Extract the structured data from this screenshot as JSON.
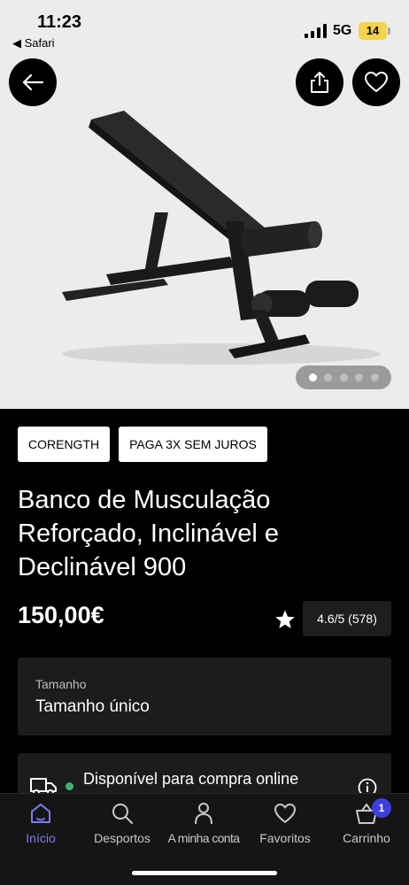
{
  "status_bar": {
    "time": "11:23",
    "back_app": "◀ Safari",
    "network": "5G",
    "battery": "14"
  },
  "hero": {
    "icons": [
      "back-arrow-icon",
      "share-icon",
      "heart-icon"
    ],
    "carousel_total": 5,
    "carousel_active": 1
  },
  "product": {
    "badges": [
      "CORENGTH",
      "PAGA 3X SEM JUROS"
    ],
    "title": "Banco de Musculação Reforçado, Inclinável e Declinável 900",
    "price": "150,00€",
    "rating": "4.6/5 (578)"
  },
  "size": {
    "label": "Tamanho",
    "value": "Tamanho único"
  },
  "availability": {
    "text": "Disponível para compra online",
    "status_color": "#3cb371"
  },
  "tabs": [
    {
      "label": "Início",
      "icon": "home-icon"
    },
    {
      "label": "Desportos",
      "icon": "search-icon"
    },
    {
      "label": "A minha conta",
      "icon": "user-icon"
    },
    {
      "label": "Favoritos",
      "icon": "heart-icon"
    },
    {
      "label": "Carrinho",
      "icon": "basket-icon"
    }
  ],
  "cart_count": "1",
  "colors": {
    "accent": "#7b7cf7",
    "badge": "#3b3fdc"
  }
}
